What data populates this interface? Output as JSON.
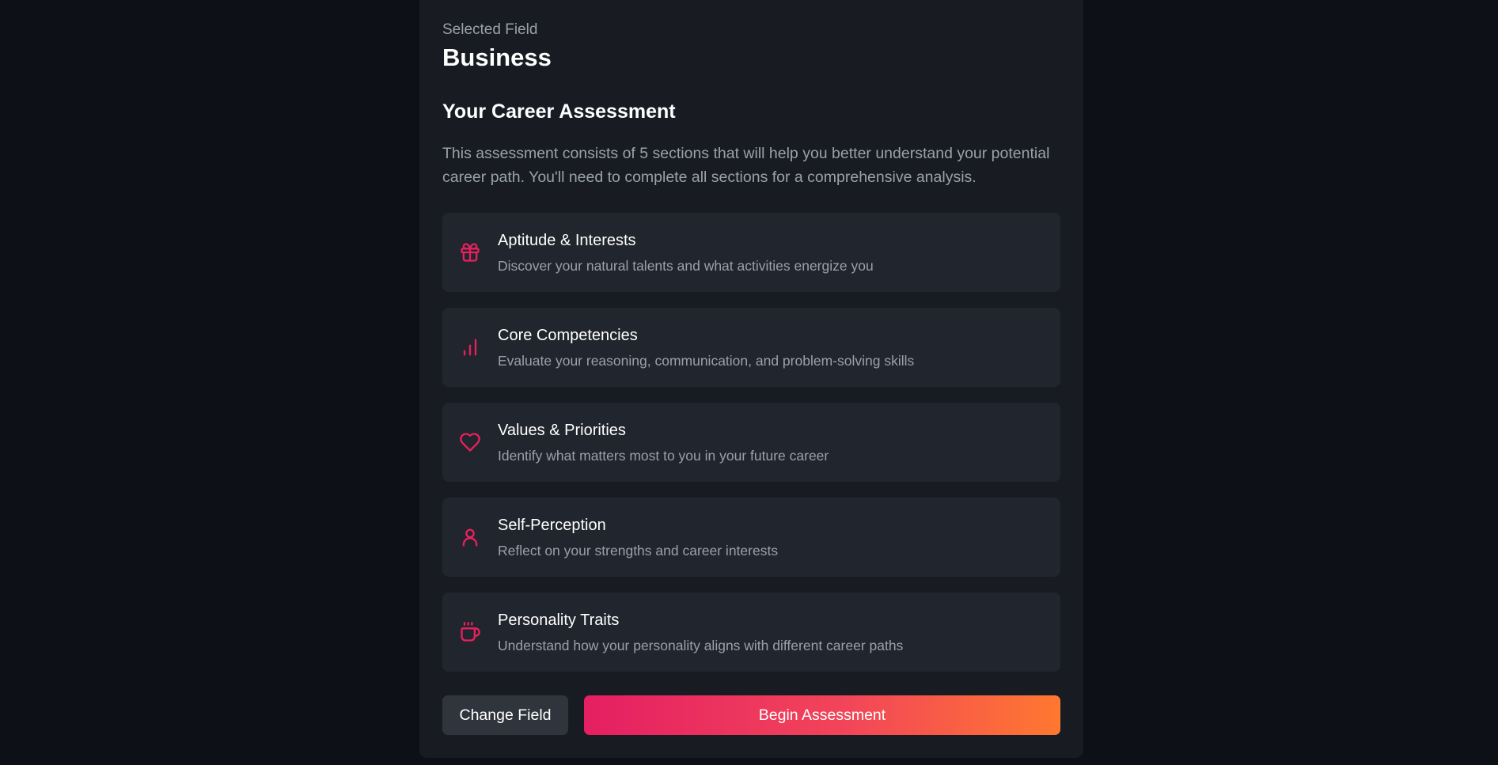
{
  "header": {
    "selected_label": "Selected Field",
    "field_name": "Business"
  },
  "assessment": {
    "heading": "Your Career Assessment",
    "intro": "This assessment consists of 5 sections that will help you better understand your potential career path. You'll need to complete all sections for a comprehensive analysis.",
    "sections": [
      {
        "icon": "gift-icon",
        "title": "Aptitude & Interests",
        "description": "Discover your natural talents and what activities energize you"
      },
      {
        "icon": "bar-chart-icon",
        "title": "Core Competencies",
        "description": "Evaluate your reasoning, communication, and problem-solving skills"
      },
      {
        "icon": "heart-icon",
        "title": "Values & Priorities",
        "description": "Identify what matters most to you in your future career"
      },
      {
        "icon": "user-icon",
        "title": "Self-Perception",
        "description": "Reflect on your strengths and career interests"
      },
      {
        "icon": "coffee-icon",
        "title": "Personality Traits",
        "description": "Understand how your personality aligns with different career paths"
      }
    ]
  },
  "actions": {
    "change_label": "Change Field",
    "begin_label": "Begin Assessment"
  },
  "colors": {
    "accent": "#e8205e",
    "gradient_start": "#e51f63",
    "gradient_end": "#ff7830",
    "background": "#0d1117",
    "panel": "#181c22",
    "card": "#21252d"
  }
}
